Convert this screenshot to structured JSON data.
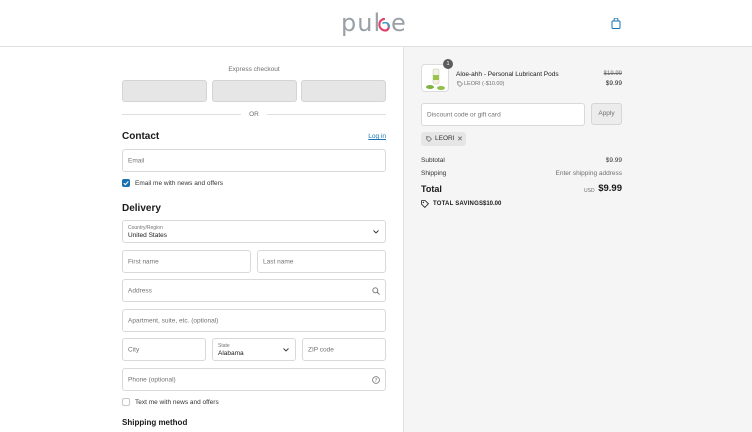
{
  "header": {
    "logo_text": "pulse"
  },
  "express": {
    "title": "Express checkout",
    "or": "OR"
  },
  "contact": {
    "title": "Contact",
    "login_link": "Log in",
    "email_placeholder": "Email",
    "news_label": "Email me with news and offers",
    "news_checked": true
  },
  "delivery": {
    "title": "Delivery",
    "country_label": "Country/Region",
    "country_value": "United States",
    "first_name_placeholder": "First name",
    "last_name_placeholder": "Last name",
    "address_placeholder": "Address",
    "apartment_placeholder": "Apartment, suite, etc. (optional)",
    "city_placeholder": "City",
    "state_label": "State",
    "state_value": "Alabama",
    "zip_placeholder": "ZIP code",
    "phone_placeholder": "Phone (optional)",
    "text_label": "Text me with news and offers",
    "text_checked": false
  },
  "shipping_method": {
    "title": "Shipping method"
  },
  "summary": {
    "product": {
      "qty": "1",
      "name": "Aloe-ahh - Personal Lubricant Pods",
      "discount": "LEORI (-$10.00)",
      "original_price": "$19.99",
      "price": "$9.99"
    },
    "discount_placeholder": "Discount code or gift card",
    "apply_label": "Apply",
    "chip_code": "LEORI",
    "chip_remove": "✕",
    "subtotal_label": "Subtotal",
    "subtotal_value": "$9.99",
    "shipping_label": "Shipping",
    "shipping_value": "Enter shipping address",
    "total_label": "Total",
    "currency": "USD",
    "total_value": "$9.99",
    "savings_label": "TOTAL SAVINGS",
    "savings_value": "$10.00"
  },
  "colors": {
    "accent": "#1773b0",
    "summary_bg": "#f5f5f5",
    "logo_gray": "#9aa1a6",
    "logo_accent": "#e0446b"
  }
}
